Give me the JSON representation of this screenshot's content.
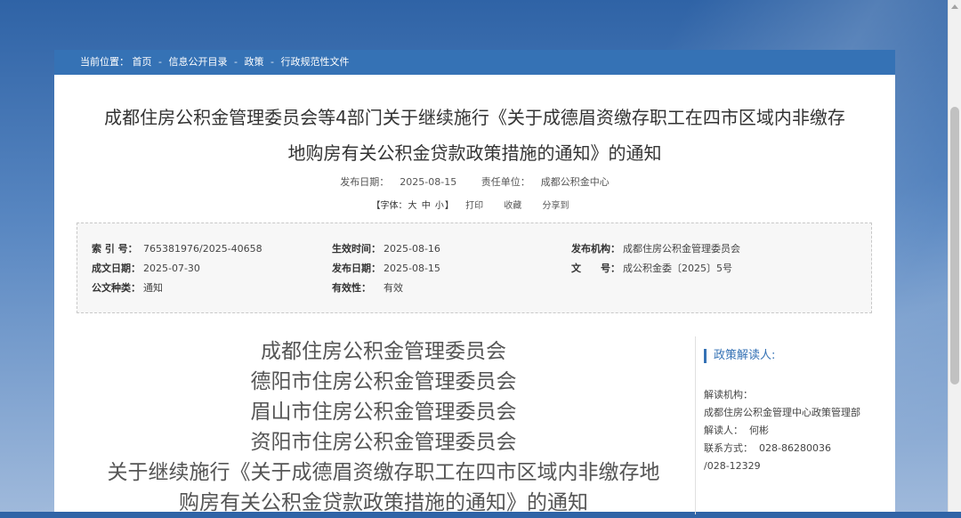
{
  "breadcrumb": {
    "prefix": "当前位置：",
    "items": [
      "首页",
      "信息公开目录",
      "政策",
      "行政规范性文件"
    ],
    "sep": "-"
  },
  "title": {
    "line1": "成都住房公积金管理委员会等4部门关于继续施行《关于成德眉资缴存职工在四市区域内非缴存",
    "line2": "地购房有关公积金贷款政策措施的通知》的通知"
  },
  "meta": {
    "publish_date_label": "发布日期：",
    "publish_date": "2025-08-15",
    "unit_label": "责任单位：",
    "unit": "成都公积金中心"
  },
  "tools": {
    "font_prefix": "【字体：",
    "font_large": "大",
    "font_medium": "中",
    "font_small": "小",
    "font_suffix": "】",
    "print": "打印",
    "favorite": "收藏",
    "share": "分享到"
  },
  "info": {
    "index_label": "索 引 号：",
    "index_value": "765381976/2025-40658",
    "effective_time_label": "生效时间：",
    "effective_time_value": "2025-08-16",
    "issuer_label": "发布机构：",
    "issuer_value": "成都住房公积金管理委员会",
    "written_date_label": "成文日期：",
    "written_date_value": "2025-07-30",
    "issue_date_label": "发布日期：",
    "issue_date_value": "2025-08-15",
    "doc_no_label": "文　　号：",
    "doc_no_value": "成公积金委〔2025〕5号",
    "doc_type_label": "公文种类：",
    "doc_type_value": "通知",
    "validity_label": "有效性：",
    "validity_value": "有效"
  },
  "body": {
    "issuers": [
      "成都住房公积金管理委员会",
      "德阳市住房公积金管理委员会",
      "眉山市住房公积金管理委员会",
      "资阳市住房公积金管理委员会"
    ],
    "heading_line1": "关于继续施行《关于成德眉资缴存职工在四市区域内非缴存地",
    "heading_line2": "购房有关公积金贷款政策措施的通知》的通知"
  },
  "sidebar": {
    "title": "政策解读人:",
    "org_label": "解读机构：",
    "org_value": "成都住房公积金管理中心政策管理部",
    "person_label": "解读人：",
    "person_value": "何彬",
    "contact_label": "联系方式：",
    "contact_value": "028-86280036",
    "contact_value2": "/028-12329"
  },
  "colors": {
    "accent": "#3572b5",
    "background_top": "#2f63a6",
    "background_bottom": "#9fb9db"
  }
}
